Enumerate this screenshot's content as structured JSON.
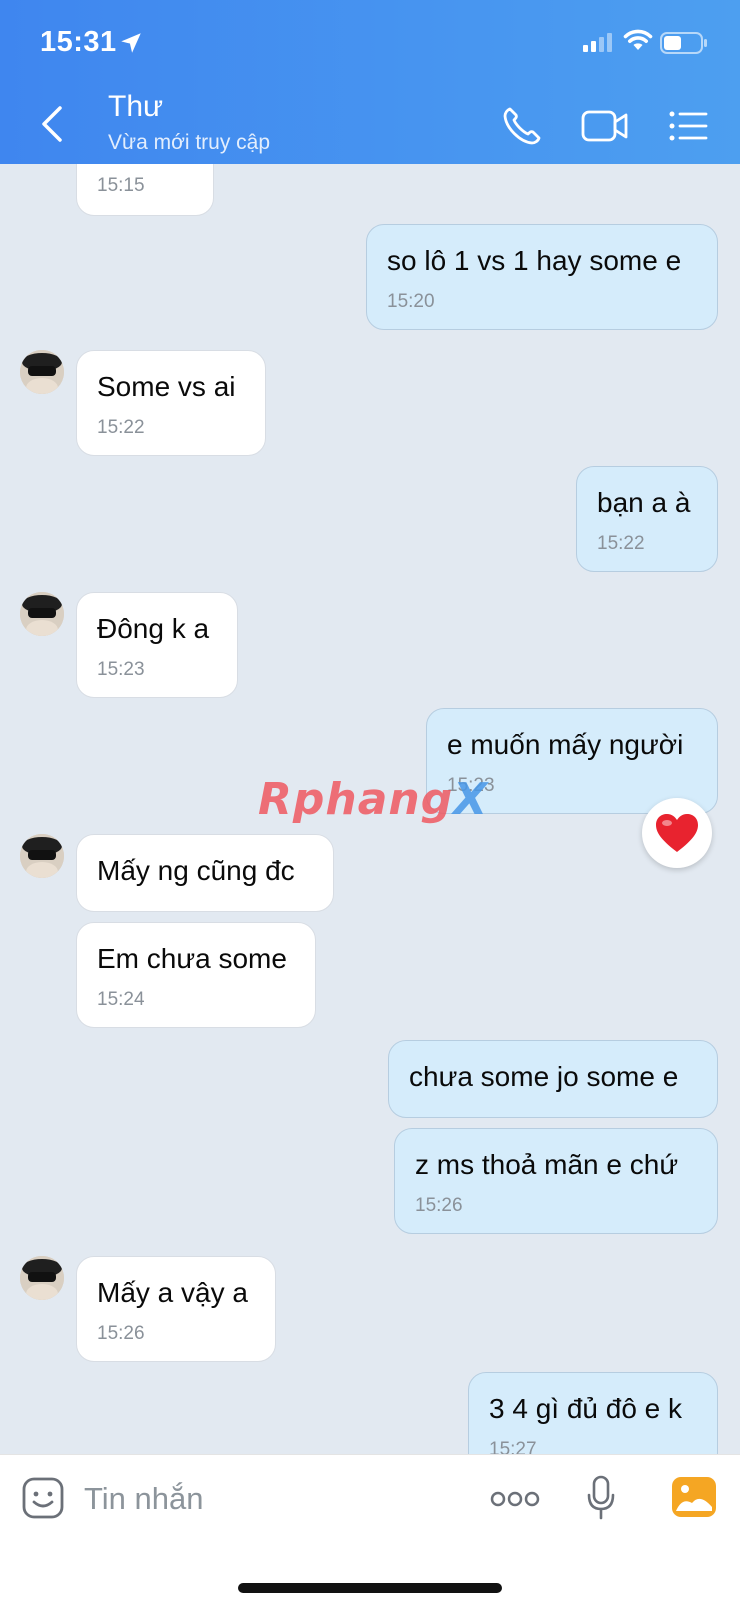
{
  "status_bar": {
    "time": "15:31"
  },
  "header": {
    "name": "Thư",
    "status": "Vừa mới truy cập"
  },
  "messages": [
    {
      "dir": "in",
      "text": "",
      "time": "15:15"
    },
    {
      "dir": "out",
      "text": "so lô 1 vs 1 hay some e",
      "time": "15:20"
    },
    {
      "dir": "in",
      "text": "Some vs ai",
      "time": "15:22"
    },
    {
      "dir": "out",
      "text": "bạn a à",
      "time": "15:22"
    },
    {
      "dir": "in",
      "text": "Đông k a",
      "time": "15:23"
    },
    {
      "dir": "out",
      "text": "e muốn mấy người",
      "time": "15:23"
    },
    {
      "dir": "in",
      "text": "Mấy ng cũng đc",
      "time": ""
    },
    {
      "dir": "in",
      "text": "Em chưa some",
      "time": "15:24"
    },
    {
      "dir": "out",
      "text": "chưa some jo some e",
      "time": ""
    },
    {
      "dir": "out",
      "text": "z ms thoả mãn e chứ",
      "time": "15:26"
    },
    {
      "dir": "in",
      "text": "Mấy a vậy a",
      "time": "15:26"
    },
    {
      "dir": "out",
      "text": "3 4 gì đủ đô e k",
      "time": "15:27"
    }
  ],
  "reaction": {
    "icon": "heart-icon",
    "color": "#e8232f"
  },
  "watermark": {
    "part1": "Rphang",
    "part2": "X"
  },
  "input": {
    "placeholder": "Tin nhắn"
  },
  "colors": {
    "header": "#4394ef",
    "outgoing_bubble": "#d5ecfb",
    "incoming_bubble": "#ffffff",
    "chat_bg": "#e2e9f1"
  }
}
